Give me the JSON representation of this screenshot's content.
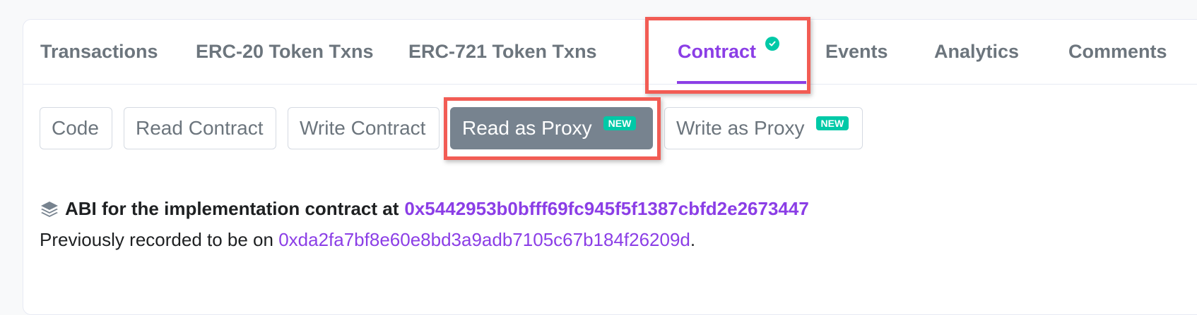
{
  "tabs": [
    {
      "label": "Transactions"
    },
    {
      "label": "ERC-20 Token Txns"
    },
    {
      "label": "ERC-721 Token Txns"
    },
    {
      "label": "Contract",
      "active": true,
      "icon": "check-circle-icon"
    },
    {
      "label": "Events"
    },
    {
      "label": "Analytics"
    },
    {
      "label": "Comments"
    }
  ],
  "subtabs": [
    {
      "label": "Code"
    },
    {
      "label": "Read Contract"
    },
    {
      "label": "Write Contract"
    },
    {
      "label": "Read as Proxy",
      "badge": "NEW",
      "active": true
    },
    {
      "label": "Write as Proxy",
      "badge": "NEW"
    }
  ],
  "abi": {
    "icon": "layers-icon",
    "text": "ABI for the implementation contract at",
    "address": "0x5442953b0bfff69fc945f5f1387cbfd2e2673447"
  },
  "previous": {
    "text": "Previously recorded to be on",
    "address": "0xda2fa7bf8e60e8bd3a9adb7105c67b184f26209d",
    "suffix": "."
  },
  "colors": {
    "accent": "#8b3ee6",
    "badge": "#00c9a7",
    "highlight": "#f25c54",
    "active_subtab": "#77838f"
  }
}
